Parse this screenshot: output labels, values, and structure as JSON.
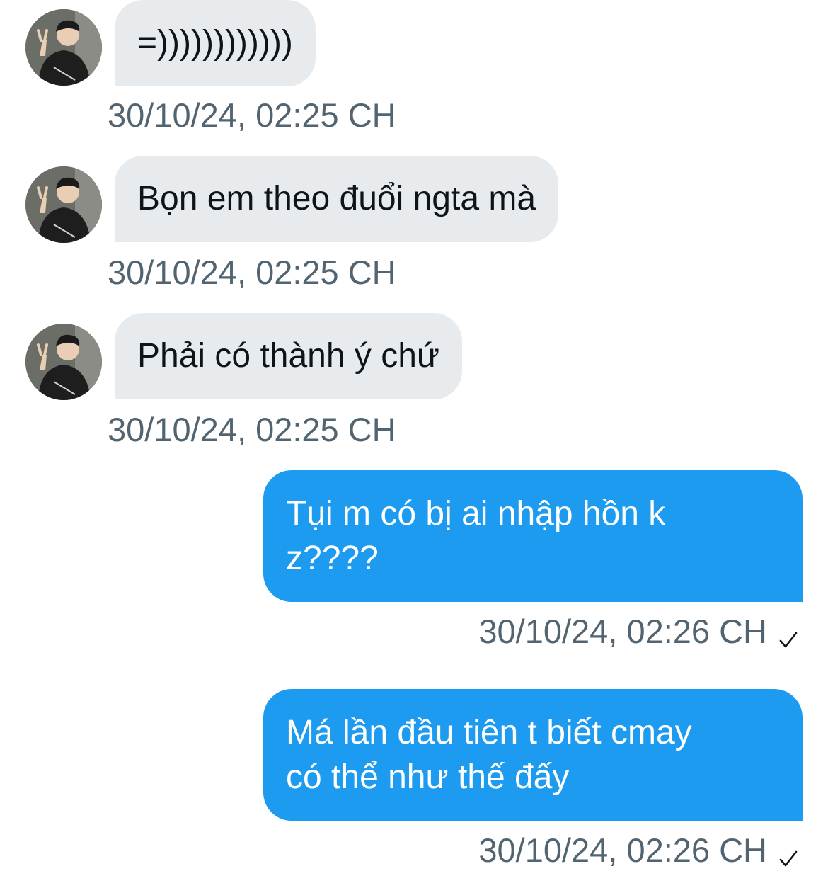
{
  "messages": [
    {
      "direction": "incoming",
      "text": "=))))))))))))",
      "time": "30/10/24, 02:25 CH",
      "sender_avatar": "avatar"
    },
    {
      "direction": "incoming",
      "text": "Bọn em theo đuổi ngta mà",
      "time": "30/10/24, 02:25 CH",
      "sender_avatar": "avatar"
    },
    {
      "direction": "incoming",
      "text": "Phải có thành ý chứ",
      "time": "30/10/24, 02:25 CH",
      "sender_avatar": "avatar"
    },
    {
      "direction": "outgoing",
      "line1": "Tụi m có bị ai nhập hồn k",
      "line2": "z????",
      "time": "30/10/24, 02:26 CH",
      "status_icon": "check-icon"
    },
    {
      "direction": "outgoing",
      "line1": "Má lần đầu tiên t biết cmay",
      "line2": "có thể như thế đấy",
      "time": "30/10/24, 02:26 CH",
      "status_icon": "check-icon"
    }
  ],
  "colors": {
    "incoming_bubble": "#e8ebee",
    "outgoing_bubble": "#1d9bf0",
    "timestamp": "#536471"
  }
}
